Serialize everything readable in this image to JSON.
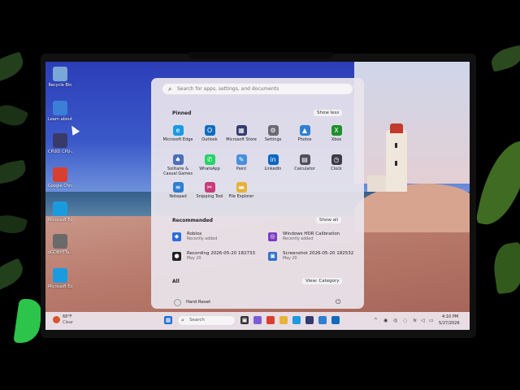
{
  "desktop": {
    "icons": [
      {
        "label": "Recycle Bin",
        "icon": "recycle-bin-icon",
        "color": "#7aa6d8"
      },
      {
        "label": "Learn about this picture",
        "icon": "learn-picture-icon",
        "color": "#3b7fd6"
      },
      {
        "label": "CPUID CPU-Z",
        "icon": "cpuz-icon",
        "color": "#3a3a6a"
      },
      {
        "label": "Google Chrome",
        "icon": "chrome-icon",
        "color": "#d93f2f"
      },
      {
        "label": "Microsoft Edge",
        "icon": "edge-icon",
        "color": "#1a9be0"
      },
      {
        "label": "dGDBHTTa...",
        "icon": "app-icon",
        "color": "#6a6a6a"
      },
      {
        "label": "Microsoft Edge",
        "icon": "edge-icon",
        "color": "#1a9be0"
      }
    ]
  },
  "start_menu": {
    "search_placeholder": "Search for apps, settings, and documents",
    "pinned_title": "Pinned",
    "show_less": "Show less",
    "pinned": [
      {
        "label": "Microsoft Edge",
        "icon": "edge-icon",
        "color": "#1a9be0",
        "glyph": "e"
      },
      {
        "label": "Outlook",
        "icon": "outlook-icon",
        "color": "#0f6cbd",
        "glyph": "O"
      },
      {
        "label": "Microsoft Store",
        "icon": "store-icon",
        "color": "#333c6e",
        "glyph": "▦"
      },
      {
        "label": "Settings",
        "icon": "gear-icon",
        "color": "#6b6b74",
        "glyph": "⚙"
      },
      {
        "label": "Photos",
        "icon": "photos-icon",
        "color": "#2f7fd3",
        "glyph": "▲"
      },
      {
        "label": "Xbox",
        "icon": "xbox-icon",
        "color": "#1e8e2a",
        "glyph": "X"
      },
      {
        "label": "Solitaire & Casual Games",
        "icon": "solitaire-icon",
        "color": "#4d6fb8",
        "glyph": "♠"
      },
      {
        "label": "WhatsApp",
        "icon": "whatsapp-icon",
        "color": "#25d366",
        "glyph": "✆"
      },
      {
        "label": "Paint",
        "icon": "paint-icon",
        "color": "#4a90d9",
        "glyph": "✎"
      },
      {
        "label": "LinkedIn",
        "icon": "linkedin-icon",
        "color": "#0a66c2",
        "glyph": "in"
      },
      {
        "label": "Calculator",
        "icon": "calculator-icon",
        "color": "#4f4f58",
        "glyph": "▤"
      },
      {
        "label": "Clock",
        "icon": "clock-icon",
        "color": "#3c3c44",
        "glyph": "◷"
      },
      {
        "label": "Notepad",
        "icon": "notepad-icon",
        "color": "#2f7fd3",
        "glyph": "≡"
      },
      {
        "label": "Snipping Tool",
        "icon": "snipping-tool-icon",
        "color": "#c73c7a",
        "glyph": "✂"
      },
      {
        "label": "File Explorer",
        "icon": "folder-icon",
        "color": "#e8b23a",
        "glyph": "▬"
      }
    ],
    "recommended_title": "Recommended",
    "show_all": "Show all",
    "recommended": [
      {
        "title": "Roblox",
        "subtitle": "Recently added",
        "icon": "roblox-icon",
        "color": "#2d6ce0",
        "glyph": "◆"
      },
      {
        "title": "Windows HDR Calibration",
        "subtitle": "Recently added",
        "icon": "hdr-calibration-icon",
        "color": "#7d3cc2",
        "glyph": "◎"
      },
      {
        "title": "Recording 2026-05-20 182733",
        "subtitle": "May 20",
        "icon": "recording-icon",
        "color": "#222222",
        "glyph": "●"
      },
      {
        "title": "Screenshot 2026-05-20 182532",
        "subtitle": "May 20",
        "icon": "screenshot-icon",
        "color": "#2f6fc8",
        "glyph": "▣"
      }
    ],
    "all_title": "All",
    "view_category": "View: Category",
    "user_name": "Hard Reset",
    "power_glyph": "⏻"
  },
  "taskbar": {
    "weather_temp": "68°F",
    "weather_desc": "Clear",
    "search_label": "Search",
    "apps": [
      {
        "icon": "copilot-icon",
        "color": "#7b5cd6"
      },
      {
        "icon": "chrome-icon",
        "color": "#d93f2f"
      },
      {
        "icon": "file-explorer-icon",
        "color": "#e8b23a"
      },
      {
        "icon": "edge-icon",
        "color": "#1a9be0"
      },
      {
        "icon": "store-icon",
        "color": "#333c6e"
      },
      {
        "icon": "photos-icon",
        "color": "#2f7fd3"
      },
      {
        "icon": "outlook-icon",
        "color": "#0f6cbd"
      }
    ],
    "time": "4:10 PM",
    "date": "5/27/2026"
  }
}
